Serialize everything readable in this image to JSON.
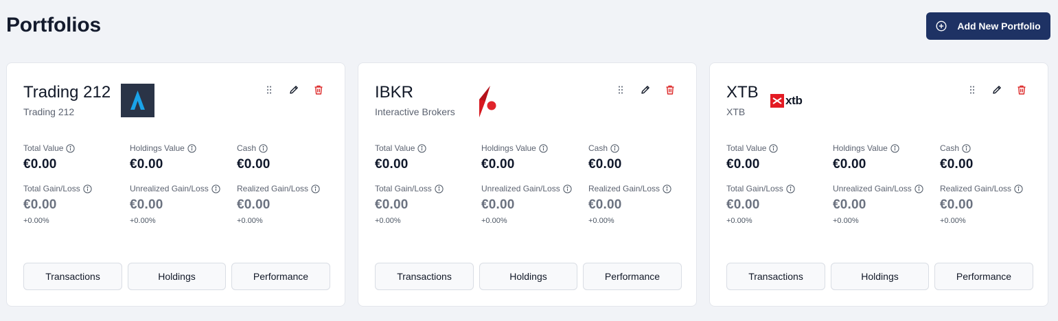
{
  "header": {
    "title": "Portfolios",
    "add_button_label": "Add New Portfolio"
  },
  "colors": {
    "primary": "#1e3264",
    "danger": "#dc2626",
    "trading212_logo_bg": "#2a3447",
    "trading212_logo_fg": "#1aa3e8",
    "ibkr_red": "#d71920",
    "xtb_red": "#e31b23"
  },
  "portfolios": [
    {
      "name": "Trading 212",
      "broker": "Trading 212",
      "logo": "trading212-logo",
      "total_value_label": "Total Value",
      "total_value": "€0.00",
      "holdings_value_label": "Holdings Value",
      "holdings_value": "€0.00",
      "cash_label": "Cash",
      "cash": "€0.00",
      "total_gain_label": "Total Gain/Loss",
      "total_gain": "€0.00",
      "total_gain_pct": "+0.00%",
      "unrealized_label": "Unrealized Gain/Loss",
      "unrealized": "€0.00",
      "unrealized_pct": "+0.00%",
      "realized_label": "Realized Gain/Loss",
      "realized": "€0.00",
      "realized_pct": "+0.00%",
      "buttons": [
        "Transactions",
        "Holdings",
        "Performance"
      ]
    },
    {
      "name": "IBKR",
      "broker": "Interactive Brokers",
      "logo": "ibkr-logo",
      "total_value_label": "Total Value",
      "total_value": "€0.00",
      "holdings_value_label": "Holdings Value",
      "holdings_value": "€0.00",
      "cash_label": "Cash",
      "cash": "€0.00",
      "total_gain_label": "Total Gain/Loss",
      "total_gain": "€0.00",
      "total_gain_pct": "+0.00%",
      "unrealized_label": "Unrealized Gain/Loss",
      "unrealized": "€0.00",
      "unrealized_pct": "+0.00%",
      "realized_label": "Realized Gain/Loss",
      "realized": "€0.00",
      "realized_pct": "+0.00%",
      "buttons": [
        "Transactions",
        "Holdings",
        "Performance"
      ]
    },
    {
      "name": "XTB",
      "broker": "XTB",
      "logo": "xtb-logo",
      "logo_text": "xtb",
      "total_value_label": "Total Value",
      "total_value": "€0.00",
      "holdings_value_label": "Holdings Value",
      "holdings_value": "€0.00",
      "cash_label": "Cash",
      "cash": "€0.00",
      "total_gain_label": "Total Gain/Loss",
      "total_gain": "€0.00",
      "total_gain_pct": "+0.00%",
      "unrealized_label": "Unrealized Gain/Loss",
      "unrealized": "€0.00",
      "unrealized_pct": "+0.00%",
      "realized_label": "Realized Gain/Loss",
      "realized": "€0.00",
      "realized_pct": "+0.00%",
      "buttons": [
        "Transactions",
        "Holdings",
        "Performance"
      ]
    }
  ]
}
